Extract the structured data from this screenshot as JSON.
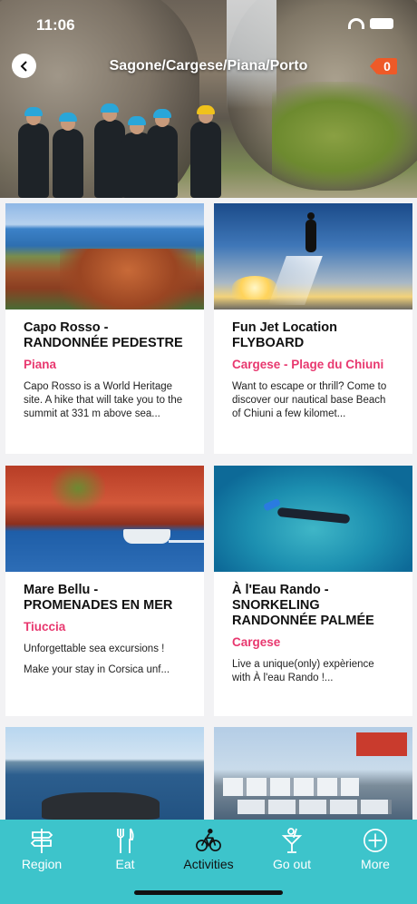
{
  "status_bar": {
    "time": "11:06"
  },
  "header": {
    "title": "Sagone/Cargese/Piana/Porto",
    "cart_count": "0"
  },
  "cards": [
    {
      "title": "Capo Rosso - RANDONNÉE PEDESTRE",
      "place": "Piana",
      "desc1": "Capo Rosso is a World Heritage site. A hike that will take you to the summit at 331 m above sea...",
      "desc2": ""
    },
    {
      "title": "Fun Jet Location FLYBOARD",
      "place": "Cargese - Plage du Chiuni",
      "desc1": "Want to escape or thrill? Come to discover our nautical base Beach of Chiuni a few kilomet...",
      "desc2": ""
    },
    {
      "title": "Mare Bellu - PROMENADES EN MER",
      "place": "Tiuccia",
      "desc1": "Unforgettable sea excursions !",
      "desc2": "Make your stay in Corsica unf..."
    },
    {
      "title": "À l'Eau Rando - SNORKELING RANDONNÉE PALMÉE",
      "place": "Cargese",
      "desc1": "Live a unique(only) expèrience with À l'eau Rando !...",
      "desc2": ""
    }
  ],
  "tabs": [
    {
      "label": "Region",
      "icon": "signpost-icon"
    },
    {
      "label": "Eat",
      "icon": "fork-knife-icon"
    },
    {
      "label": "Activities",
      "icon": "bicycle-icon"
    },
    {
      "label": "Go out",
      "icon": "cocktail-icon"
    },
    {
      "label": "More",
      "icon": "plus-circle-icon"
    }
  ],
  "colors": {
    "accent": "#e8386f",
    "tabbar": "#3dc4cb",
    "badge": "#ee5a28"
  }
}
